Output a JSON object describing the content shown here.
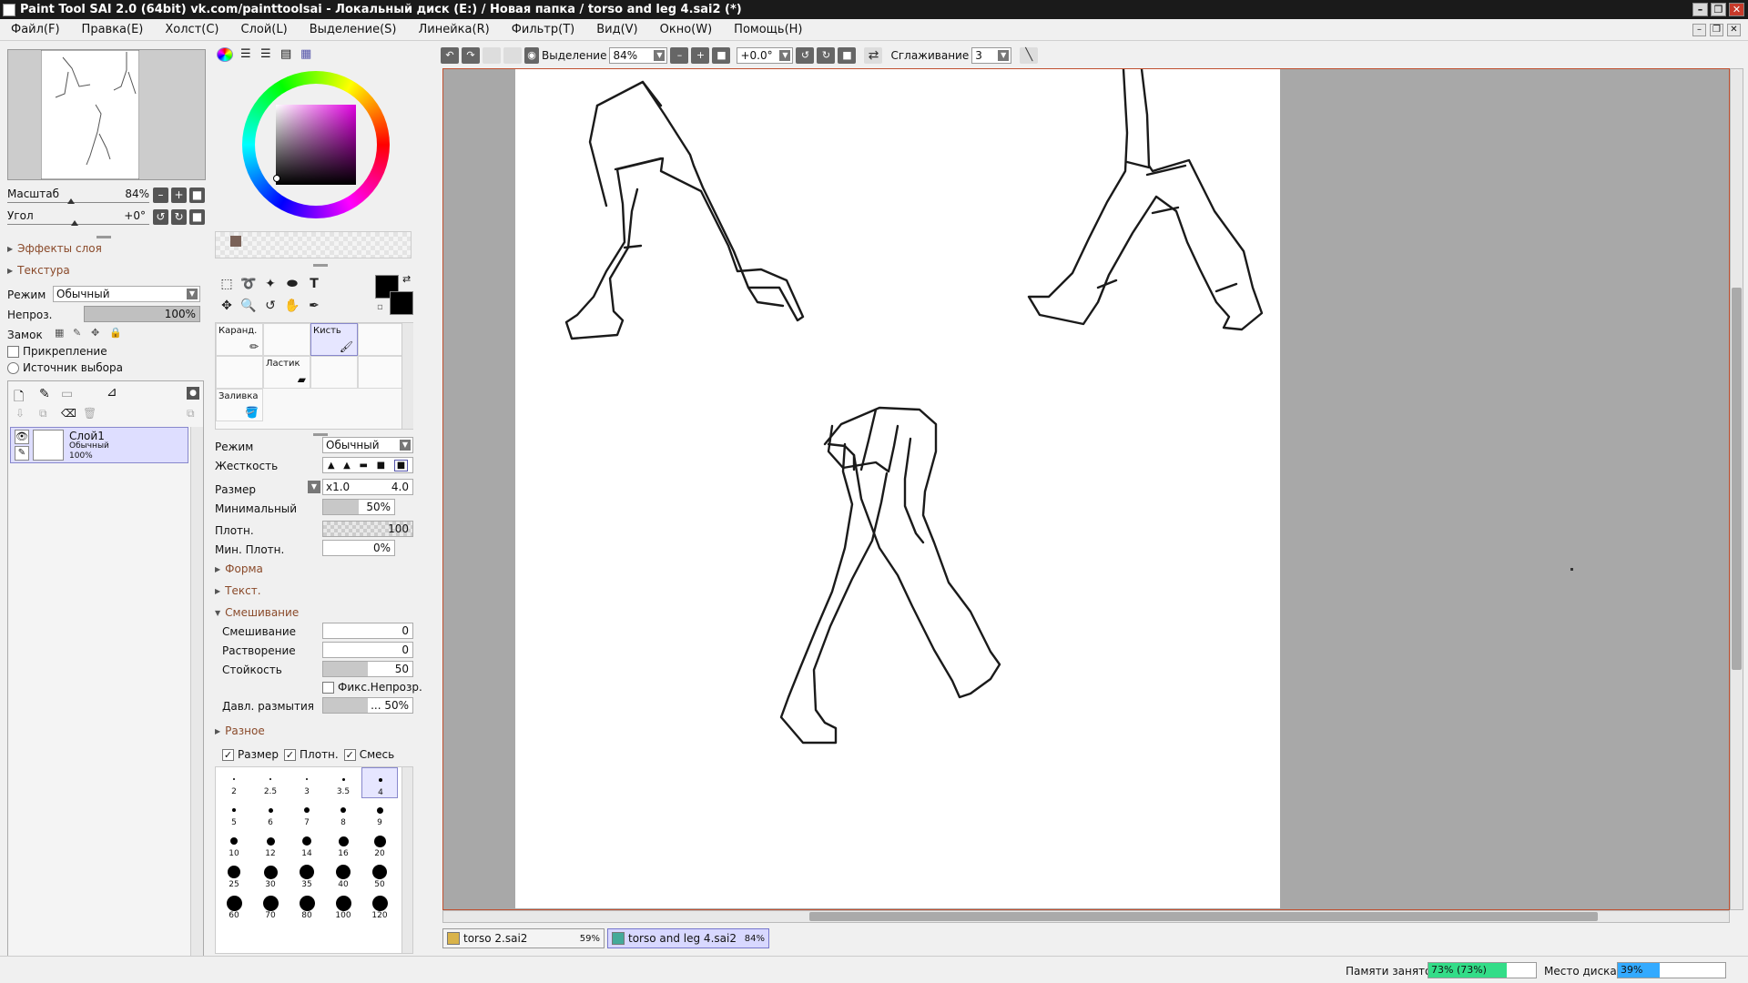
{
  "window": {
    "title": "Paint Tool SAI 2.0 (64bit) vk.com/painttoolsai - Локальный диск (E:) / Новая папка / torso and leg 4.sai2 (*)"
  },
  "menu": [
    "Файл(F)",
    "Правка(E)",
    "Холст(C)",
    "Слой(L)",
    "Выделение(S)",
    "Линейка(R)",
    "Фильтр(T)",
    "Вид(V)",
    "Окно(W)",
    "Помощь(H)"
  ],
  "navigator": {
    "zoom_label": "Масштаб",
    "zoom_value": "84%",
    "angle_label": "Угол",
    "angle_value": "+0°"
  },
  "layer_panel": {
    "effects_label": "Эффекты слоя",
    "texture_label": "Текстура",
    "mode_label": "Режим",
    "mode_value": "Обычный",
    "opacity_label": "Непроз.",
    "opacity_value": "100%",
    "lock_label": "Замок",
    "clip_label": "Прикрепление",
    "source_label": "Источник выбора",
    "layer": {
      "name": "Слой1",
      "mode": "Обычный",
      "opacity": "100%"
    }
  },
  "brush_tools": {
    "pencil": "Каранд.",
    "brush": "Кисть",
    "eraser": "Ластик",
    "fill": "Заливка"
  },
  "brush_settings": {
    "mode_label": "Режим",
    "mode_value": "Обычный",
    "hardness_label": "Жесткость",
    "size_label": "Размер",
    "size_mult": "x1.0",
    "size_value": "4.0",
    "min_label": "Минимальный",
    "min_value": "50%",
    "density_label": "Плотн.",
    "density_value": "100",
    "min_density_label": "Мин. Плотн.",
    "min_density_value": "0%",
    "shape_label": "Форма",
    "text_label": "Текст.",
    "blend_section": "Смешивание",
    "blend_label": "Смешивание",
    "blend_value": "0",
    "dilution_label": "Растворение",
    "dilution_value": "0",
    "persistence_label": "Стойкость",
    "persistence_value": "50",
    "fix_opacity_label": "Фикс.Непрозр.",
    "blur_label": "Давл. размытия",
    "blur_value": "... 50%",
    "misc_label": "Разное",
    "chk_size": "Размер",
    "chk_density": "Плотн.",
    "chk_blend": "Смесь"
  },
  "brush_sizes": [
    "2",
    "2.5",
    "3",
    "3.5",
    "4",
    "5",
    "6",
    "7",
    "8",
    "9",
    "10",
    "12",
    "14",
    "16",
    "20",
    "25",
    "30",
    "35",
    "40",
    "50",
    "60",
    "70",
    "80",
    "100",
    "120"
  ],
  "toolbar": {
    "selection_label": "Выделение",
    "zoom_value": "84%",
    "angle_value": "+0.0°",
    "smoothing_label": "Сглаживание",
    "smoothing_value": "3"
  },
  "tabs": [
    {
      "name": "torso 2.sai2",
      "zoom": "59%"
    },
    {
      "name": "torso and leg 4.sai2",
      "zoom": "84%"
    }
  ],
  "status": {
    "memory_label": "Памяти занято",
    "memory_value": "73% (73%)",
    "memory_fraction": 0.73,
    "disk_label": "Место диска",
    "disk_value": "39%",
    "disk_fraction": 0.39
  },
  "colors": {
    "accent": "#8888cc",
    "memory_bar": "#33dd88",
    "disk_bar": "#33aaff",
    "primary": "#000000",
    "swatch": "#7a6258"
  }
}
